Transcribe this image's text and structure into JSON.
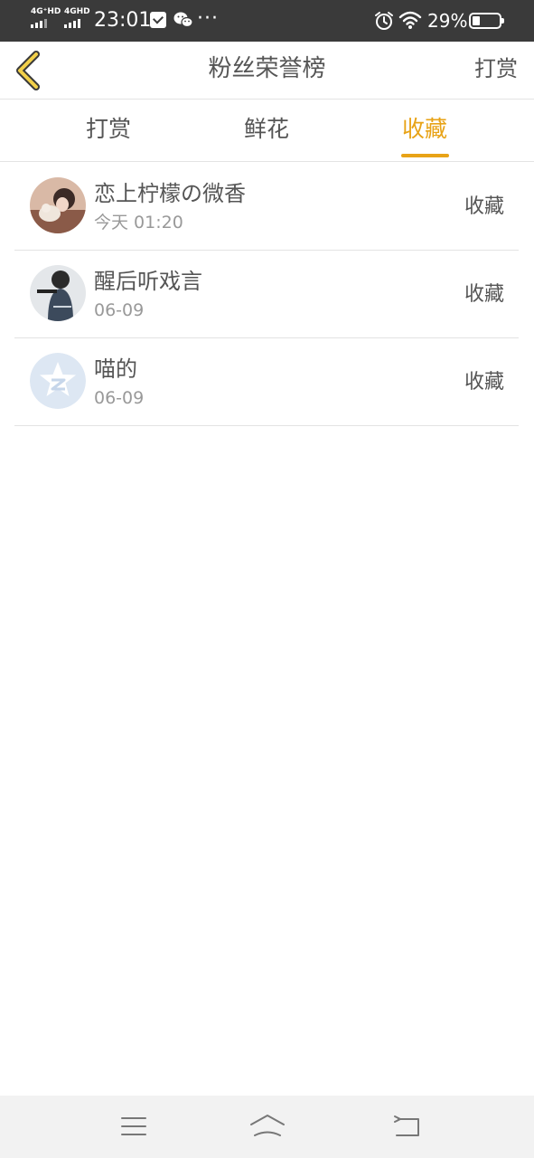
{
  "status_bar": {
    "net1": "4G⁺HD",
    "net2": "4GHD",
    "time": "23:01",
    "more": "···",
    "battery": "29%"
  },
  "header": {
    "title": "粉丝荣誉榜",
    "action": "打赏"
  },
  "tabs": [
    {
      "label": "打赏",
      "active": false
    },
    {
      "label": "鲜花",
      "active": false
    },
    {
      "label": "收藏",
      "active": true
    }
  ],
  "list": [
    {
      "name": "恋上柠檬の微香",
      "date": "今天 01:20",
      "type": "收藏"
    },
    {
      "name": "醒后听戏言",
      "date": "06-09",
      "type": "收藏"
    },
    {
      "name": "喵的",
      "date": "06-09",
      "type": "收藏"
    }
  ],
  "colors": {
    "accent": "#e8a317",
    "status_bar": "#3a3a3a",
    "text": "#555555",
    "subtext": "#999999"
  },
  "icons": {
    "back": "chevron-left-icon",
    "menu": "menu-icon",
    "home": "home-icon",
    "return": "return-icon"
  }
}
